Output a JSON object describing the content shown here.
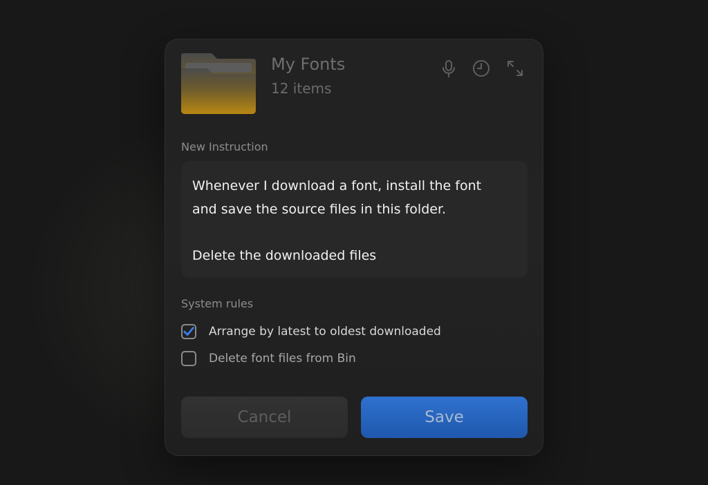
{
  "folder": {
    "title": "My Fonts",
    "item_count": "12 items",
    "color": "#e8a713"
  },
  "header_icons": [
    "microphone-icon",
    "clock-icon",
    "expand-icon"
  ],
  "instruction": {
    "label": "New Instruction",
    "lines": [
      "Whenever I download a font, install the font",
      "and save the source files in this folder.",
      "Delete the downloaded files"
    ]
  },
  "system_rules": {
    "label": "System rules",
    "items": [
      {
        "label": "Arrange by latest to oldest downloaded",
        "checked": true
      },
      {
        "label": "Delete font files from Bin",
        "checked": false
      }
    ]
  },
  "buttons": {
    "cancel_label": "Cancel",
    "save_label": "Save"
  },
  "colors": {
    "accent": "#2f71cf",
    "check": "#3b82f0"
  }
}
